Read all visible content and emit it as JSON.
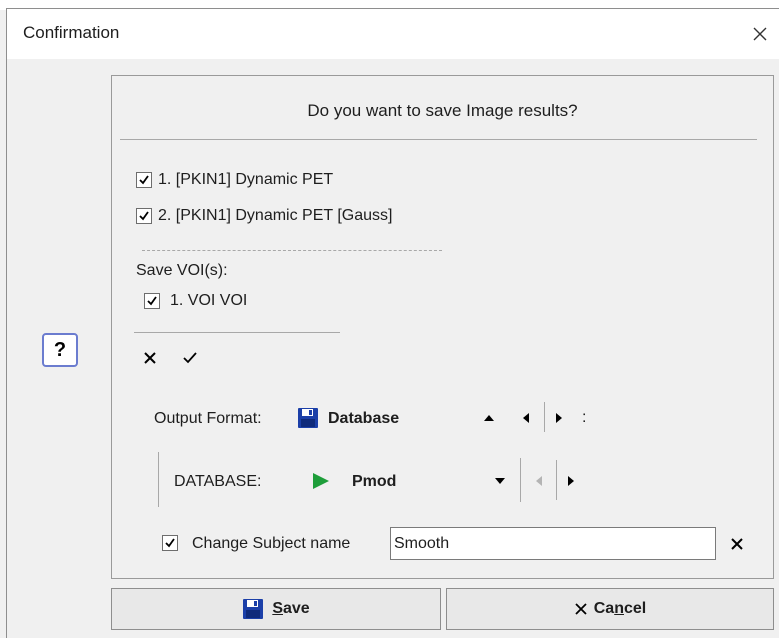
{
  "window": {
    "title": "Confirmation"
  },
  "dialog": {
    "question": "Do you want to save Image results?",
    "images": [
      {
        "label": "1. [PKIN1] Dynamic PET",
        "checked": true
      },
      {
        "label": "2. [PKIN1] Dynamic PET [Gauss]",
        "checked": true
      }
    ],
    "voi_header": "Save VOI(s):",
    "vois": [
      {
        "label": "1. VOI VOI",
        "checked": true
      }
    ],
    "output_format": {
      "label": "Output Format:",
      "value": "Database",
      "trailing": ":"
    },
    "database": {
      "label": "DATABASE:",
      "value": "Pmod"
    },
    "change_subject": {
      "label": "Change Subject name",
      "checked": true,
      "value": "Smooth"
    }
  },
  "buttons": {
    "save": {
      "first": "S",
      "rest": "ave"
    },
    "cancel": {
      "pre": "Ca",
      "ul": "n",
      "rest": "cel"
    }
  },
  "colors": {
    "help_border": "#6b7ccf",
    "play_green": "#1e9e3a",
    "floppy_blue": "#1b3fa8"
  }
}
